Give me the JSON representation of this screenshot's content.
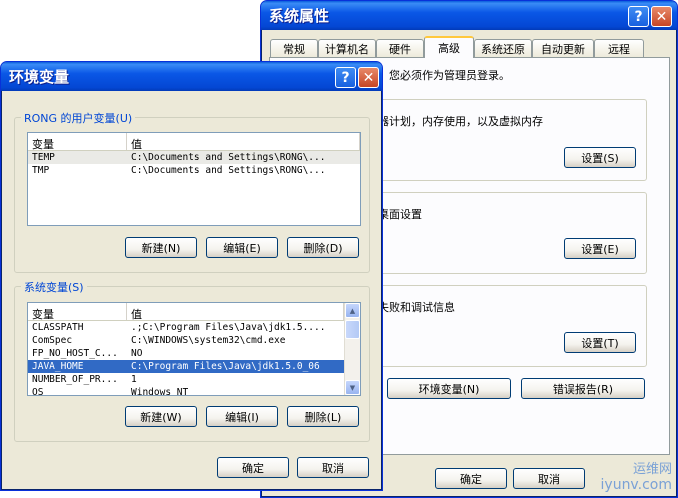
{
  "sys_props": {
    "title": "系统属性",
    "tabs": [
      "常规",
      "计算机名",
      "硬件",
      "高级",
      "系统还原",
      "自动更新",
      "远程"
    ],
    "active_tab": "高级",
    "admin_note": "，您必须作为管理员登录。",
    "perf_text": "器计划，内存使用，以及虚拟内存",
    "profile_text": "桌面设置",
    "startup_text": "失败和调试信息",
    "settings_label_1": "设置(S)",
    "settings_label_2": "设置(E)",
    "settings_label_3": "设置(T)",
    "env_button": "环境变量(N)",
    "error_button": "错误报告(R)",
    "ok": "确定",
    "cancel": "取消"
  },
  "env_vars": {
    "title": "环境变量",
    "user_group_title": "RONG 的用户变量(U)",
    "sys_group_title": "系统变量(S)",
    "col_var": "变量",
    "col_value": "值",
    "user_rows": [
      {
        "name": "TEMP",
        "value": "C:\\Documents and Settings\\RONG\\..."
      },
      {
        "name": "TMP",
        "value": "C:\\Documents and Settings\\RONG\\..."
      }
    ],
    "sys_rows": [
      {
        "name": "CLASSPATH",
        "value": ".;C:\\Program Files\\Java\\jdk1.5...."
      },
      {
        "name": "ComSpec",
        "value": "C:\\WINDOWS\\system32\\cmd.exe"
      },
      {
        "name": "FP_NO_HOST_C...",
        "value": "NO"
      },
      {
        "name": "JAVA_HOME",
        "value": "C:\\Program Files\\Java\\jdk1.5.0_06"
      },
      {
        "name": "NUMBER_OF_PR...",
        "value": "1"
      },
      {
        "name": "OS",
        "value": "Windows_NT"
      }
    ],
    "user_new": "新建(N)",
    "user_edit": "编辑(E)",
    "user_delete": "删除(D)",
    "sys_new": "新建(W)",
    "sys_edit": "编辑(I)",
    "sys_delete": "删除(L)",
    "ok": "确定",
    "cancel": "取消"
  },
  "watermark": {
    "line1": "运维网",
    "line2": "iyunv.com"
  }
}
